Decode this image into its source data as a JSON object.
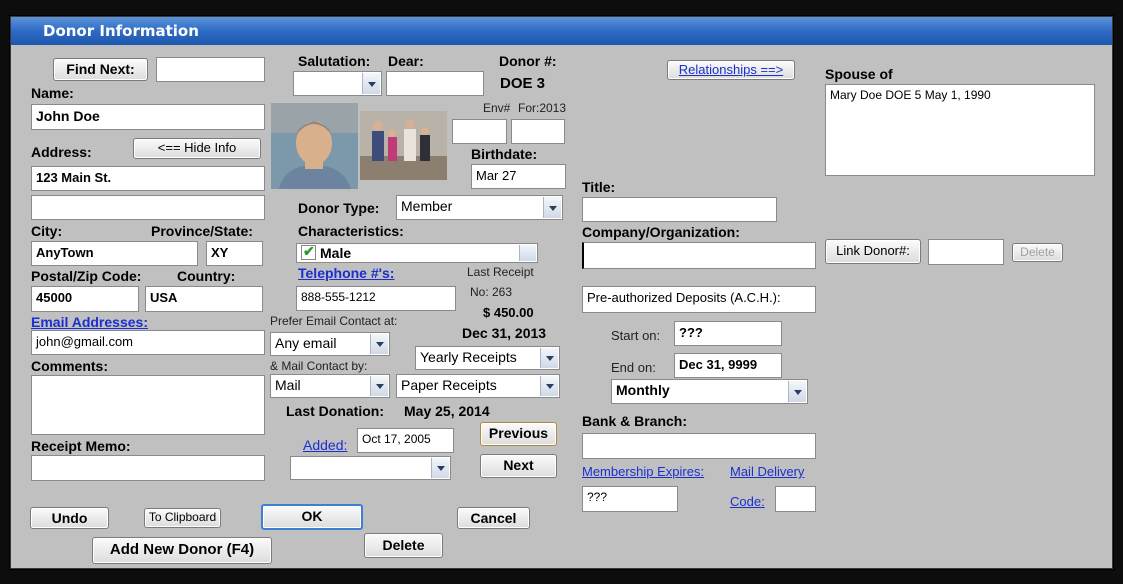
{
  "window": {
    "title": "Donor Information"
  },
  "find": {
    "button": "Find Next:",
    "value": ""
  },
  "name": {
    "label": "Name:",
    "value": "John Doe"
  },
  "address": {
    "label": "Address:",
    "hide_info_button": "<== Hide Info",
    "line1": "123 Main St.",
    "line2": ""
  },
  "city": {
    "label": "City:",
    "value": "AnyTown"
  },
  "province": {
    "label": "Province/State:",
    "value": "XY"
  },
  "postal": {
    "label": "Postal/Zip Code:",
    "value": "45000"
  },
  "country": {
    "label": "Country:",
    "value": "USA"
  },
  "email": {
    "link": "Email Addresses:",
    "value": "john@gmail.com"
  },
  "comments": {
    "label": "Comments:",
    "value": ""
  },
  "receipt_memo": {
    "label": "Receipt Memo:",
    "value": ""
  },
  "salutation": {
    "label": "Salutation:",
    "value": "",
    "dear_label": "Dear:",
    "dear_value": ""
  },
  "donor_number": {
    "label": "Donor #:",
    "value": "DOE  3"
  },
  "envelope": {
    "env_label": "Env#",
    "for_label": "For:2013",
    "env_value": "",
    "for_value": ""
  },
  "birthdate": {
    "label": "Birthdate:",
    "value": "Mar 27"
  },
  "donor_type": {
    "label": "Donor Type:",
    "value": "Member"
  },
  "characteristics": {
    "label": "Characteristics:",
    "value": "Male",
    "checked": true
  },
  "telephone": {
    "link": "Telephone #'s:",
    "value": "888-555-1212"
  },
  "last_receipt": {
    "label": "Last Receipt",
    "number": "No: 263",
    "amount": "$ 450.00",
    "date": "Dec 31, 2013"
  },
  "contact": {
    "email_label": "Prefer Email Contact at:",
    "email_value": "Any email",
    "mail_label": "& Mail Contact by:",
    "mail_value": "Mail",
    "receipt_freq": "Yearly Receipts",
    "receipt_type": "Paper Receipts"
  },
  "last_donation": {
    "label": "Last Donation:",
    "value": "May 25, 2014"
  },
  "added": {
    "link": "Added:",
    "value": "Oct 17, 2005",
    "dropdown": ""
  },
  "nav": {
    "previous": "Previous",
    "next": "Next"
  },
  "buttons": {
    "undo": "Undo",
    "clipboard": "To Clipboard",
    "ok": "OK",
    "cancel": "Cancel",
    "add_new": "Add New Donor (F4)",
    "delete": "Delete"
  },
  "relationships": {
    "button": "Relationships ==>",
    "label": "Spouse of",
    "value": "Mary Doe  DOE  5  May 1, 1990"
  },
  "title": {
    "label": "Title:",
    "value": ""
  },
  "company": {
    "label": "Company/Organization:",
    "value": ""
  },
  "link_donor": {
    "button": "Link Donor#:",
    "value": "",
    "delete": "Delete"
  },
  "ach": {
    "label": "Pre-authorized Deposits (A.C.H.):",
    "start_label": "Start on:",
    "start_value": "???",
    "end_label": "End on:",
    "end_value": "Dec 31, 9999",
    "frequency": "Monthly"
  },
  "bank": {
    "label": "Bank & Branch:",
    "value": ""
  },
  "membership": {
    "link": "Membership Expires:",
    "value": "???"
  },
  "mail_delivery": {
    "link_line1": "Mail Delivery",
    "link_line2": "Code:",
    "value": ""
  },
  "colors": {
    "title_bar": "#2e6bc4",
    "panel": "#c0c0c0",
    "link": "#1a2fd0",
    "button_focus": "#3c7fd6"
  }
}
